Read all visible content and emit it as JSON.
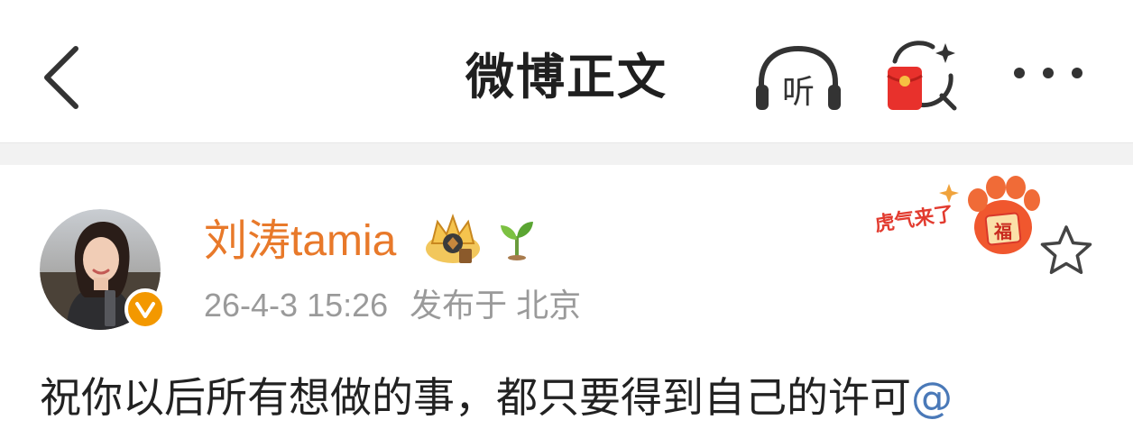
{
  "nav": {
    "title": "微博正文",
    "listen_label": "听"
  },
  "post": {
    "username": "刘涛tamia",
    "time": "26-4-3 15:26",
    "published_at": "发布于 北京",
    "text": "祝你以后所有想做的事，都只要得到自己的许可",
    "mention": "@",
    "sticker_text": "虎气来了",
    "sticker_badge": "福"
  },
  "colors": {
    "username": "#e8792a",
    "meta": "#9a9a9a",
    "mention": "#4a79b8",
    "verify": "#f39800"
  }
}
